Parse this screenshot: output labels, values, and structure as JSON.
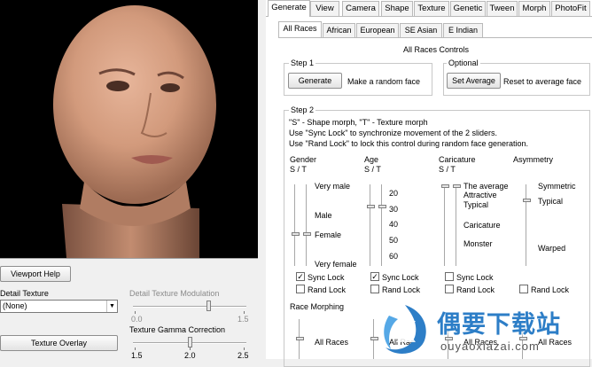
{
  "left": {
    "viewport_help": "Viewport Help",
    "detail_texture_label": "Detail Texture",
    "detail_texture_value": "(None)",
    "modulation_label": "Detail Texture Modulation",
    "modulation_ticks": [
      "0.0",
      "1.5"
    ],
    "texture_overlay": "Texture Overlay",
    "gamma_label": "Texture Gamma Correction",
    "gamma_ticks": [
      "1.5",
      "2.0",
      "2.5"
    ]
  },
  "tabs": [
    "Generate",
    "View",
    "Camera",
    "Shape",
    "Texture",
    "Genetic",
    "Tween",
    "Morph",
    "PhotoFit"
  ],
  "subtabs": [
    "All Races",
    "African",
    "European",
    "SE Asian",
    "E Indian"
  ],
  "controls_title": "All Races Controls",
  "step1": {
    "title": "Step 1",
    "generate_button": "Generate",
    "generate_desc": "Make a random face"
  },
  "optional": {
    "title": "Optional",
    "set_average_button": "Set Average",
    "set_average_desc": "Reset to average face"
  },
  "step2": {
    "title": "Step 2",
    "help": [
      "\"S\" - Shape morph, \"T\" - Texture morph",
      "Use \"Sync Lock\" to synchronize movement of the 2 sliders.",
      "Use \"Rand Lock\" to lock this control during random face generation."
    ],
    "gender": {
      "title": "Gender",
      "st": "S / T",
      "labels": [
        "Very male",
        "Male",
        "Female",
        "Very female"
      ]
    },
    "age": {
      "title": "Age",
      "st": "S / T",
      "labels": [
        "20",
        "30",
        "40",
        "50",
        "60"
      ]
    },
    "caricature": {
      "title": "Caricature",
      "st": "S / T",
      "labels": [
        "The average",
        "Attractive",
        "Typical",
        "Caricature",
        "Monster"
      ]
    },
    "asymmetry": {
      "title": "Asymmetry",
      "labels": [
        "Symmetric",
        "Typical",
        "Warped"
      ]
    },
    "sync_lock": "Sync Lock",
    "rand_lock": "Rand Lock",
    "race_morphing": "Race Morphing",
    "race_labels": [
      "All Races",
      "All Races",
      "All Races",
      "All Races"
    ]
  },
  "watermark": {
    "title": "偶要下载站",
    "url": "ouyaoxiazai.com"
  }
}
